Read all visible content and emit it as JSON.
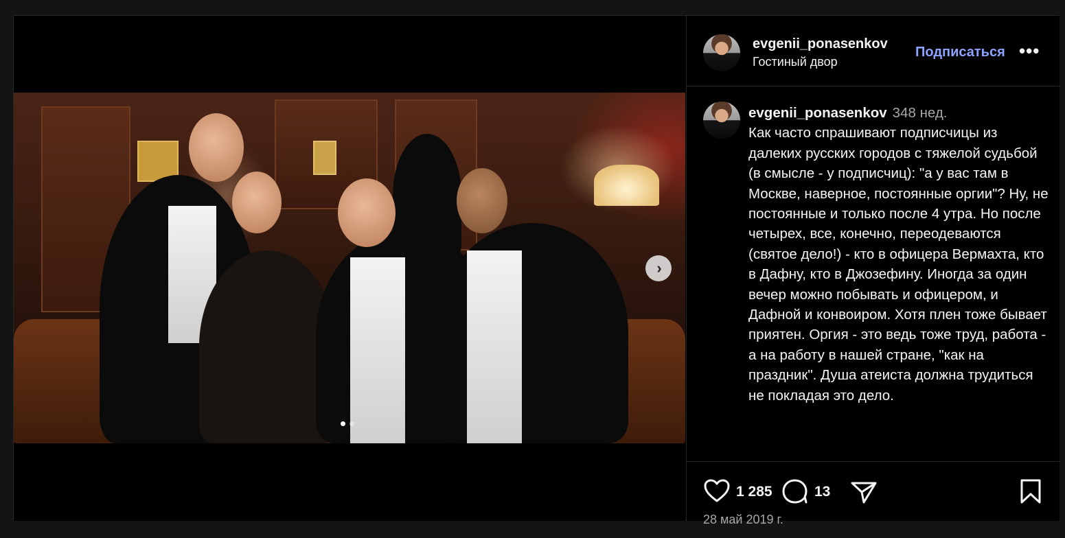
{
  "post": {
    "username": "evgenii_ponasenkov",
    "location": "Гостиный двор",
    "follow_label": "Подписаться",
    "more_label": "•••"
  },
  "caption": {
    "username": "evgenii_ponasenkov",
    "time": "348 нед.",
    "text": "Как часто спрашивают подписчицы из далеких русских городов с тяжелой судьбой (в смысле - у подписчиц): \"а у вас там в Москве, наверное, постоянные оргии\"? Ну, не постоянные и только после 4 утра. Но после четырех, все, конечно, переодеваются (святое дело!) - кто в офицера Вермахта, кто в Дафну, кто в Джозефину. Иногда за один вечер можно побывать и офицером, и Дафной и конвоиром. Хотя плен тоже бывает приятен. Оргия - это ведь тоже труд, работа - а на работу в нашей стране, \"как на праздник\". Душа атеиста должна трудиться не покладая это дело."
  },
  "stats": {
    "likes": "1 285",
    "comments": "13"
  },
  "date": "28 май 2019 г.",
  "carousel": {
    "next_glyph": "›",
    "total_slides": 2,
    "active_slide": 1
  },
  "icons": [
    "heart-icon",
    "comment-icon",
    "share-icon",
    "bookmark-icon",
    "chevron-right-icon"
  ]
}
